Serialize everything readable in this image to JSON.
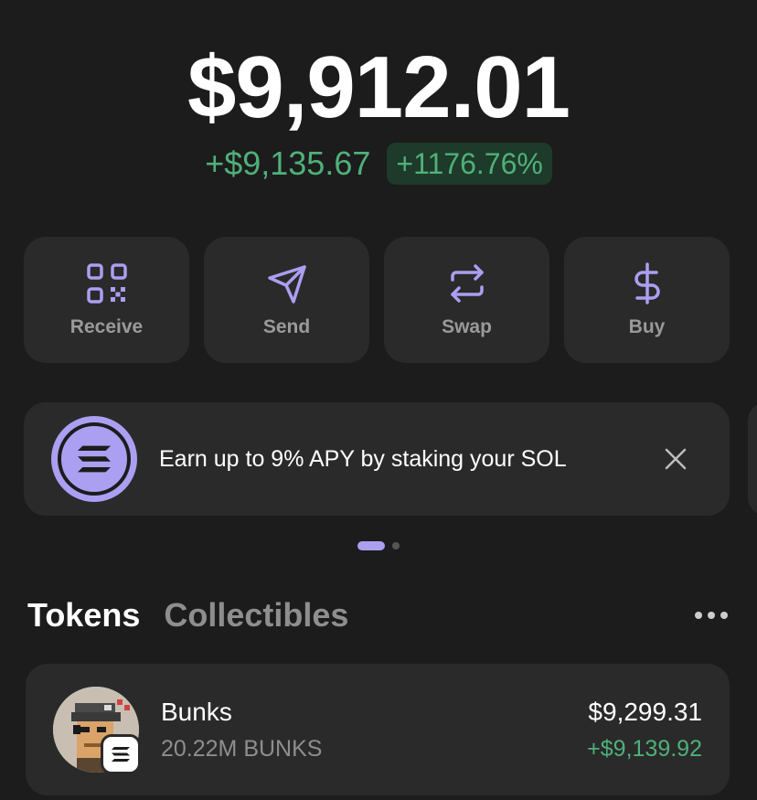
{
  "balance": {
    "total": "$9,912.01",
    "change_amount": "+$9,135.67",
    "change_percent": "+1176.76%"
  },
  "actions": [
    {
      "label": "Receive",
      "icon": "qr-code-icon"
    },
    {
      "label": "Send",
      "icon": "send-icon"
    },
    {
      "label": "Swap",
      "icon": "swap-icon"
    },
    {
      "label": "Buy",
      "icon": "dollar-icon"
    }
  ],
  "promo": {
    "text": "Earn up to 9% APY by staking your SOL",
    "icon": "solana-logo-icon",
    "close_icon": "close-icon"
  },
  "tabs": {
    "tokens": "Tokens",
    "collectibles": "Collectibles"
  },
  "tokens": [
    {
      "name": "Bunks",
      "amount": "20.22M BUNKS",
      "value": "$9,299.31",
      "change": "+$9,139.92"
    }
  ],
  "colors": {
    "background": "#1c1c1c",
    "card": "#2a2a2a",
    "accent": "#ab9ff2",
    "positive": "#4fb07a",
    "positive_bg": "#1d3a2a",
    "muted": "#8e8e8e"
  }
}
